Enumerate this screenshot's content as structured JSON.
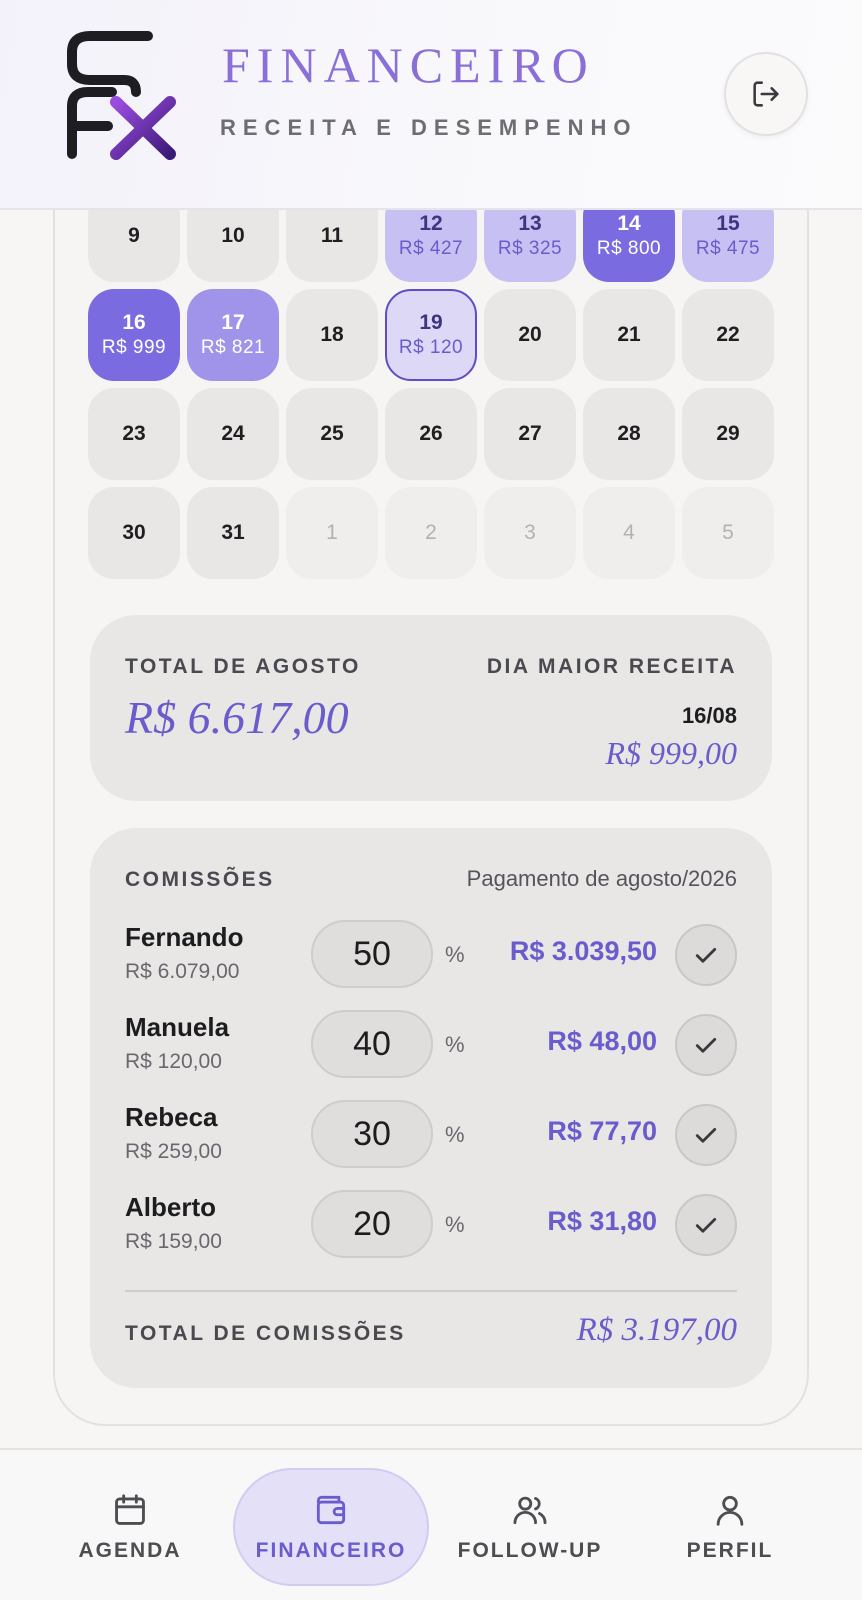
{
  "header": {
    "title": "FINANCEIRO",
    "subtitle": "RECEITA E DESEMPENHO",
    "logout_icon": "logout-icon"
  },
  "calendar": {
    "days": [
      {
        "label": "9",
        "amount": "",
        "level": "none"
      },
      {
        "label": "10",
        "amount": "",
        "level": "none"
      },
      {
        "label": "11",
        "amount": "",
        "level": "none"
      },
      {
        "label": "12",
        "amount": "R$ 427",
        "level": "lvl1"
      },
      {
        "label": "13",
        "amount": "R$ 325",
        "level": "lvl1"
      },
      {
        "label": "14",
        "amount": "R$ 800",
        "level": "lvl3"
      },
      {
        "label": "15",
        "amount": "R$ 475",
        "level": "lvl1"
      },
      {
        "label": "16",
        "amount": "R$ 999",
        "level": "lvl3"
      },
      {
        "label": "17",
        "amount": "R$ 821",
        "level": "lvl2"
      },
      {
        "label": "18",
        "amount": "",
        "level": "none"
      },
      {
        "label": "19",
        "amount": "R$ 120",
        "level": "selected"
      },
      {
        "label": "20",
        "amount": "",
        "level": "none"
      },
      {
        "label": "21",
        "amount": "",
        "level": "none"
      },
      {
        "label": "22",
        "amount": "",
        "level": "none"
      },
      {
        "label": "23",
        "amount": "",
        "level": "none"
      },
      {
        "label": "24",
        "amount": "",
        "level": "none"
      },
      {
        "label": "25",
        "amount": "",
        "level": "none"
      },
      {
        "label": "26",
        "amount": "",
        "level": "none"
      },
      {
        "label": "27",
        "amount": "",
        "level": "none"
      },
      {
        "label": "28",
        "amount": "",
        "level": "none"
      },
      {
        "label": "29",
        "amount": "",
        "level": "none"
      },
      {
        "label": "30",
        "amount": "",
        "level": "none"
      },
      {
        "label": "31",
        "amount": "",
        "level": "none"
      },
      {
        "label": "1",
        "amount": "",
        "level": "muted"
      },
      {
        "label": "2",
        "amount": "",
        "level": "muted"
      },
      {
        "label": "3",
        "amount": "",
        "level": "muted"
      },
      {
        "label": "4",
        "amount": "",
        "level": "muted"
      },
      {
        "label": "5",
        "amount": "",
        "level": "muted"
      }
    ]
  },
  "summary": {
    "total_label": "TOTAL DE AGOSTO",
    "total_value": "R$ 6.617,00",
    "best_day_label": "DIA MAIOR RECEITA",
    "best_day_date": "16/08",
    "best_day_value": "R$ 999,00"
  },
  "commissions": {
    "title": "COMISSÕES",
    "period": "Pagamento de agosto/2026",
    "percent_sign": "%",
    "rows": [
      {
        "name": "Fernando",
        "base": "R$ 6.079,00",
        "percent": "50",
        "value": "R$ 3.039,50"
      },
      {
        "name": "Manuela",
        "base": "R$ 120,00",
        "percent": "40",
        "value": "R$ 48,00"
      },
      {
        "name": "Rebeca",
        "base": "R$ 259,00",
        "percent": "30",
        "value": "R$ 77,70"
      },
      {
        "name": "Alberto",
        "base": "R$ 159,00",
        "percent": "20",
        "value": "R$ 31,80"
      }
    ],
    "total_label": "TOTAL DE COMISSÕES",
    "total_value": "R$ 3.197,00"
  },
  "nav": {
    "items": [
      {
        "label": "AGENDA",
        "icon": "calendar-icon",
        "active": false
      },
      {
        "label": "FINANCEIRO",
        "icon": "wallet-icon",
        "active": true
      },
      {
        "label": "FOLLOW-UP",
        "icon": "users-icon",
        "active": false
      },
      {
        "label": "PERFIL",
        "icon": "user-icon",
        "active": false
      }
    ]
  },
  "colors": {
    "accent": "#6a5ccc",
    "accent_light": "#c7c0f2",
    "panel": "#e8e7e6"
  }
}
